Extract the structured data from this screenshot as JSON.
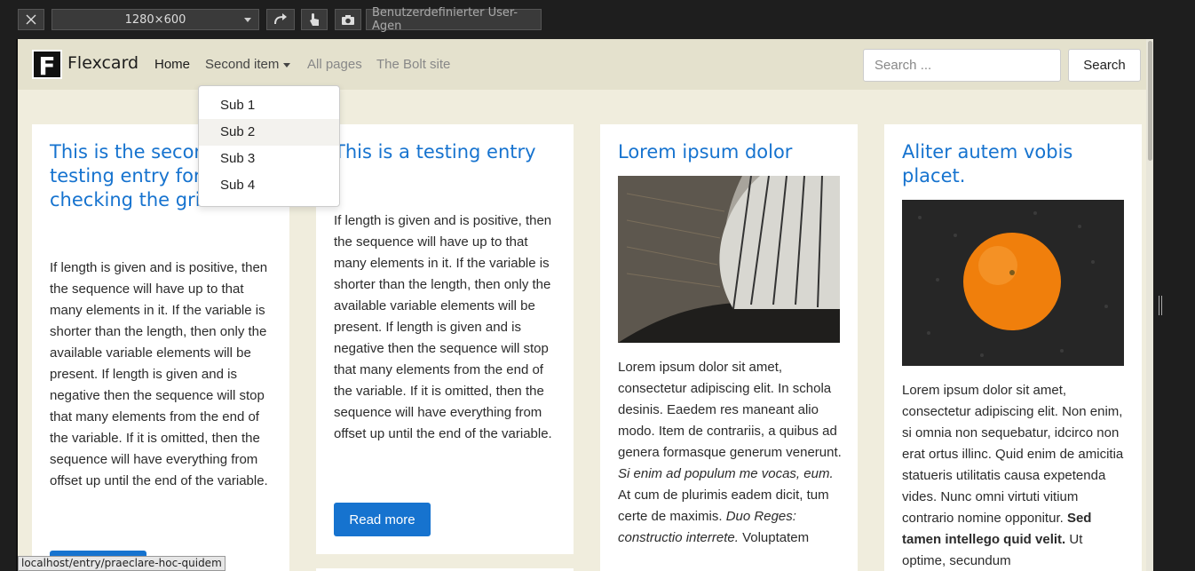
{
  "devtools": {
    "close_icon": "close-icon",
    "viewport_size": "1280×600",
    "rotate_icon": "rotate-icon",
    "touch_icon": "touch-icon",
    "screenshot_icon": "camera-icon",
    "user_agent_placeholder": "Benutzerdefinierter User-Agen"
  },
  "navbar": {
    "logo_letter": "F",
    "brand": "Flexcard",
    "links": {
      "home": "Home",
      "second_item": "Second item",
      "all_pages": "All pages",
      "bolt_site": "The Bolt site"
    },
    "search_placeholder": "Search ...",
    "search_button": "Search"
  },
  "dropdown": {
    "items": [
      "Sub 1",
      "Sub 2",
      "Sub 3",
      "Sub 4"
    ],
    "active_index": 1
  },
  "cards": [
    {
      "title": "This is the second testing entry for checking the grid",
      "text": "If length is given and is positive, then the sequence will have up to that many elements in it. If the variable is shorter than the length, then only the available variable elements will be present. If length is given and is negative then the sequence will stop that many elements from the end of the variable. If it is omitted, then the sequence will have everything from offset up until the end of the variable."
    },
    {
      "title": "This is a testing entry",
      "text": "If length is given and is positive, then the sequence will have up to that many elements in it. If the variable is shorter than the length, then only the available variable elements will be present. If length is given and is negative then the sequence will stop that many elements from the end of the variable. If it is omitted, then the sequence will have everything from offset up until the end of the variable.",
      "button": "Read more"
    },
    {
      "title": "Lorem ipsum dolor",
      "text_a": "Lorem ipsum dolor sit amet, consectetur adipiscing elit. In schola desinis. Eaedem res maneant alio modo. Item de contrariis, a quibus ad genera formasque generum venerunt.",
      "text_b": "Si enim ad populum me vocas, eum.",
      "text_c": "At cum de plurimis eadem dicit, tum certe de maximis.",
      "text_d": "Duo Reges: constructio interrete.",
      "text_e": "Voluptatem"
    },
    {
      "title": "Aliter autem vobis placet.",
      "text_a": "Lorem ipsum dolor sit amet, consectetur adipiscing elit. Non enim, si omnia non sequebatur, idcirco non erat ortus illinc. Quid enim de amicitia statueris utilitatis causa expetenda vides. Nunc omni virtuti vitium contrario nomine opponitur.",
      "text_b": "Sed tamen intellego quid velit.",
      "text_c": "Ut optime, secundum"
    }
  ],
  "status_url": "localhost/entry/praeclare-hoc-quidem"
}
